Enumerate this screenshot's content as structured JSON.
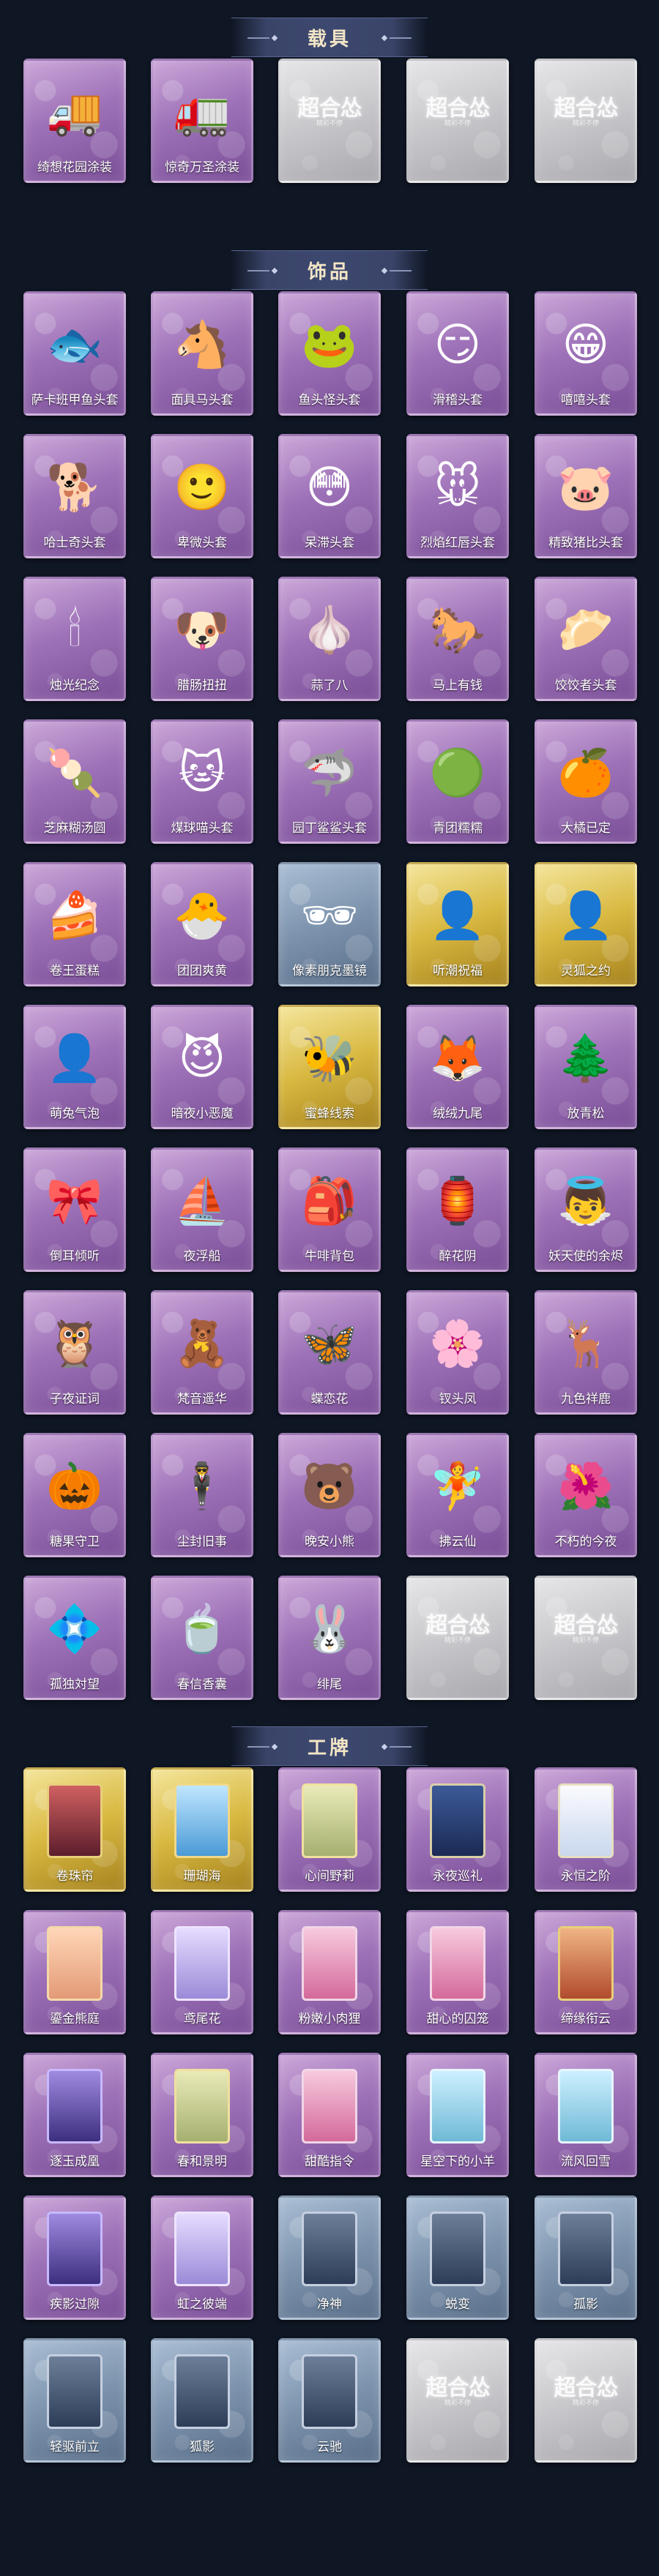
{
  "sections": [
    {
      "title": "载具",
      "items": [
        {
          "label": "绮想花园涂装",
          "theme": "purple",
          "icon": "🚚",
          "icon_name": "ice-cream-truck-icon"
        },
        {
          "label": "惊奇万圣涂装",
          "theme": "purple",
          "icon": "🚛",
          "icon_name": "halloween-truck-icon"
        },
        {
          "label": "",
          "theme": "gray",
          "placeholder": "超合怂",
          "placeholder_sub": "精彩不停"
        },
        {
          "label": "",
          "theme": "gray",
          "placeholder": "超合怂",
          "placeholder_sub": "精彩不停"
        },
        {
          "label": "",
          "theme": "gray",
          "placeholder": "超合怂",
          "placeholder_sub": "精彩不停"
        }
      ]
    },
    {
      "title": "饰品",
      "items": [
        {
          "label": "萨卡班甲鱼头套",
          "theme": "purple",
          "icon": "🐟",
          "icon_name": "fish-head-icon"
        },
        {
          "label": "面具马头套",
          "theme": "purple",
          "icon": "🐴",
          "icon_name": "horse-head-icon"
        },
        {
          "label": "鱼头怪头套",
          "theme": "purple",
          "icon": "🐸",
          "icon_name": "fish-monster-head-icon"
        },
        {
          "label": "滑稽头套",
          "theme": "purple",
          "icon": "😏",
          "icon_name": "smirk-face-icon"
        },
        {
          "label": "嘻嘻头套",
          "theme": "purple",
          "icon": "😁",
          "icon_name": "grin-face-icon"
        },
        {
          "label": "哈士奇头套",
          "theme": "purple",
          "icon": "🐕",
          "icon_name": "husky-head-icon"
        },
        {
          "label": "卑微头套",
          "theme": "purple",
          "icon": "🙂",
          "icon_name": "humble-face-icon"
        },
        {
          "label": "呆滞头套",
          "theme": "purple",
          "icon": "😳",
          "icon_name": "dazed-face-icon"
        },
        {
          "label": "烈焰红唇头套",
          "theme": "purple",
          "icon": "🐭",
          "icon_name": "red-lips-head-icon"
        },
        {
          "label": "精致猪比头套",
          "theme": "purple",
          "icon": "🐷",
          "icon_name": "pig-head-icon"
        },
        {
          "label": "烛光纪念",
          "theme": "purple",
          "icon": "🕯",
          "icon_name": "candle-icon"
        },
        {
          "label": "腊肠扭扭",
          "theme": "purple",
          "icon": "🐶",
          "icon_name": "dachshund-icon"
        },
        {
          "label": "蒜了八",
          "theme": "purple",
          "icon": "🧄",
          "icon_name": "garlic-icon"
        },
        {
          "label": "马上有钱",
          "theme": "purple",
          "icon": "🐎",
          "icon_name": "lucky-horse-icon"
        },
        {
          "label": "饺饺者头套",
          "theme": "purple",
          "icon": "🥟",
          "icon_name": "dumpling-head-icon"
        },
        {
          "label": "芝麻糊汤圆",
          "theme": "purple",
          "icon": "🍡",
          "icon_name": "rice-ball-icon"
        },
        {
          "label": "煤球喵头套",
          "theme": "purple",
          "icon": "🐱",
          "icon_name": "black-cat-head-icon"
        },
        {
          "label": "园丁鲨鲨头套",
          "theme": "purple",
          "icon": "🦈",
          "icon_name": "shark-head-icon"
        },
        {
          "label": "青团糯糯",
          "theme": "purple",
          "icon": "🟢",
          "icon_name": "green-dumpling-icon"
        },
        {
          "label": "大橘已定",
          "theme": "purple",
          "icon": "🍊",
          "icon_name": "orange-icon"
        },
        {
          "label": "卷王蛋糕",
          "theme": "purple",
          "icon": "🍰",
          "icon_name": "roll-cake-icon"
        },
        {
          "label": "团团爽黄",
          "theme": "purple",
          "icon": "🐣",
          "icon_name": "yellow-puff-icon"
        },
        {
          "label": "像素朋克墨镜",
          "theme": "blue",
          "icon": "🕶",
          "icon_name": "pixel-sunglasses-icon"
        },
        {
          "label": "听潮祝福",
          "theme": "gold",
          "icon": "👤",
          "icon_name": "tide-blessing-icon"
        },
        {
          "label": "灵狐之约",
          "theme": "gold",
          "icon": "👤",
          "icon_name": "fox-pact-icon"
        },
        {
          "label": "萌兔气泡",
          "theme": "purple",
          "icon": "👤",
          "icon_name": "bunny-bubble-icon"
        },
        {
          "label": "暗夜小恶魔",
          "theme": "purple",
          "icon": "😈",
          "icon_name": "little-devil-icon"
        },
        {
          "label": "蜜蜂线索",
          "theme": "gold",
          "icon": "🐝",
          "icon_name": "bee-icon"
        },
        {
          "label": "绒绒九尾",
          "theme": "purple",
          "icon": "🦊",
          "icon_name": "nine-tail-fox-icon"
        },
        {
          "label": "放青松",
          "theme": "purple",
          "icon": "🌲",
          "icon_name": "bonsai-icon"
        },
        {
          "label": "倒耳倾听",
          "theme": "purple",
          "icon": "🎀",
          "icon_name": "ear-ornament-icon"
        },
        {
          "label": "夜浮船",
          "theme": "purple",
          "icon": "⛵",
          "icon_name": "night-boat-icon"
        },
        {
          "label": "牛啡背包",
          "theme": "purple",
          "icon": "🎒",
          "icon_name": "coffee-backpack-icon"
        },
        {
          "label": "醉花阴",
          "theme": "purple",
          "icon": "🏮",
          "icon_name": "flower-ornament-icon"
        },
        {
          "label": "妖天使的余烬",
          "theme": "purple",
          "icon": "👼",
          "icon_name": "angel-doll-icon"
        },
        {
          "label": "子夜证词",
          "theme": "purple",
          "icon": "🦉",
          "icon_name": "midnight-owl-icon"
        },
        {
          "label": "梵音遥华",
          "theme": "purple",
          "icon": "🧸",
          "icon_name": "charm-doll-icon"
        },
        {
          "label": "蝶恋花",
          "theme": "purple",
          "icon": "🦋",
          "icon_name": "butterfly-charm-icon"
        },
        {
          "label": "钗头凤",
          "theme": "purple",
          "icon": "🌸",
          "icon_name": "phoenix-hairpin-icon"
        },
        {
          "label": "九色祥鹿",
          "theme": "purple",
          "icon": "🦌",
          "icon_name": "deer-icon"
        },
        {
          "label": "糖果守卫",
          "theme": "purple",
          "icon": "🎃",
          "icon_name": "candy-guard-icon"
        },
        {
          "label": "尘封旧事",
          "theme": "purple",
          "icon": "🕴",
          "icon_name": "dusty-memory-icon"
        },
        {
          "label": "晚安小熊",
          "theme": "purple",
          "icon": "🐻",
          "icon_name": "bear-icon"
        },
        {
          "label": "拂云仙",
          "theme": "purple",
          "icon": "🧚",
          "icon_name": "cloud-fairy-icon"
        },
        {
          "label": "不朽的今夜",
          "theme": "purple",
          "icon": "🌺",
          "icon_name": "eternal-night-icon"
        },
        {
          "label": "孤独対望",
          "theme": "purple",
          "icon": "💠",
          "icon_name": "lonely-gaze-icon"
        },
        {
          "label": "春信香囊",
          "theme": "purple",
          "icon": "🍵",
          "icon_name": "sachet-icon"
        },
        {
          "label": "绯尾",
          "theme": "purple",
          "icon": "🐰",
          "icon_name": "scarlet-tail-icon"
        },
        {
          "label": "",
          "theme": "gray",
          "placeholder": "超合怂",
          "placeholder_sub": "精彩不停"
        },
        {
          "label": "",
          "theme": "gray",
          "placeholder": "超合怂",
          "placeholder_sub": "精彩不停"
        }
      ]
    },
    {
      "title": "工牌",
      "items": [
        {
          "label": "卷珠帘",
          "theme": "gold",
          "badge": "red",
          "icon_name": "badge-icon"
        },
        {
          "label": "珊瑚海",
          "theme": "gold",
          "badge": "sky",
          "icon_name": "badge-icon"
        },
        {
          "label": "心间野莉",
          "theme": "purple",
          "badge": "mint",
          "icon_name": "badge-icon"
        },
        {
          "label": "永夜巡礼",
          "theme": "purple",
          "badge": "night",
          "icon_name": "badge-icon"
        },
        {
          "label": "永恒之阶",
          "theme": "purple",
          "badge": "white",
          "icon_name": "badge-icon"
        },
        {
          "label": "鎏金熊庭",
          "theme": "purple",
          "badge": "peach",
          "icon_name": "badge-icon"
        },
        {
          "label": "鸢尾花",
          "theme": "purple",
          "badge": "lilac",
          "icon_name": "badge-icon"
        },
        {
          "label": "粉嫩小肉狸",
          "theme": "purple",
          "badge": "pink",
          "icon_name": "badge-icon"
        },
        {
          "label": "甜心的囚笼",
          "theme": "purple",
          "badge": "pink",
          "icon_name": "badge-icon"
        },
        {
          "label": "缔缘衔云",
          "theme": "purple",
          "badge": "orange",
          "icon_name": "badge-icon"
        },
        {
          "label": "逐玉成凰",
          "theme": "purple",
          "badge": "violet",
          "icon_name": "badge-icon"
        },
        {
          "label": "春和景明",
          "theme": "purple",
          "badge": "mint",
          "icon_name": "badge-icon"
        },
        {
          "label": "甜酷指令",
          "theme": "purple",
          "badge": "pink",
          "icon_name": "badge-icon"
        },
        {
          "label": "星空下的小羊",
          "theme": "purple",
          "badge": "cyan",
          "icon_name": "badge-icon"
        },
        {
          "label": "流风回雪",
          "theme": "purple",
          "badge": "cyan",
          "icon_name": "badge-icon"
        },
        {
          "label": "疾影过隙",
          "theme": "purple",
          "badge": "violet",
          "icon_name": "badge-icon"
        },
        {
          "label": "虹之彼端",
          "theme": "purple",
          "badge": "lilac",
          "icon_name": "badge-icon"
        },
        {
          "label": "净神",
          "theme": "blue",
          "badge": "silhouette",
          "icon_name": "silhouette-badge-icon"
        },
        {
          "label": "蜕变",
          "theme": "blue",
          "badge": "silhouette",
          "icon_name": "silhouette-badge-icon"
        },
        {
          "label": "孤影",
          "theme": "blue",
          "badge": "silhouette",
          "icon_name": "silhouette-badge-icon"
        },
        {
          "label": "轻驱前立",
          "theme": "blue",
          "badge": "silhouette",
          "icon_name": "silhouette-badge-icon"
        },
        {
          "label": "狐影",
          "theme": "blue",
          "badge": "silhouette",
          "icon_name": "silhouette-badge-icon"
        },
        {
          "label": "云驰",
          "theme": "blue",
          "badge": "silhouette",
          "icon_name": "silhouette-badge-icon"
        },
        {
          "label": "",
          "theme": "gray",
          "placeholder": "超合怂",
          "placeholder_sub": "精彩不停"
        },
        {
          "label": "",
          "theme": "gray",
          "placeholder": "超合怂",
          "placeholder_sub": "精彩不停"
        }
      ]
    }
  ],
  "colors": {
    "background": "#0f1624",
    "header_band": "#3d4870",
    "header_text": "#f3e6c6",
    "card_purple": "#9e72b8",
    "card_gold": "#d8b840",
    "card_blue": "#7d93ad",
    "card_gray": "#c4c4c8"
  }
}
